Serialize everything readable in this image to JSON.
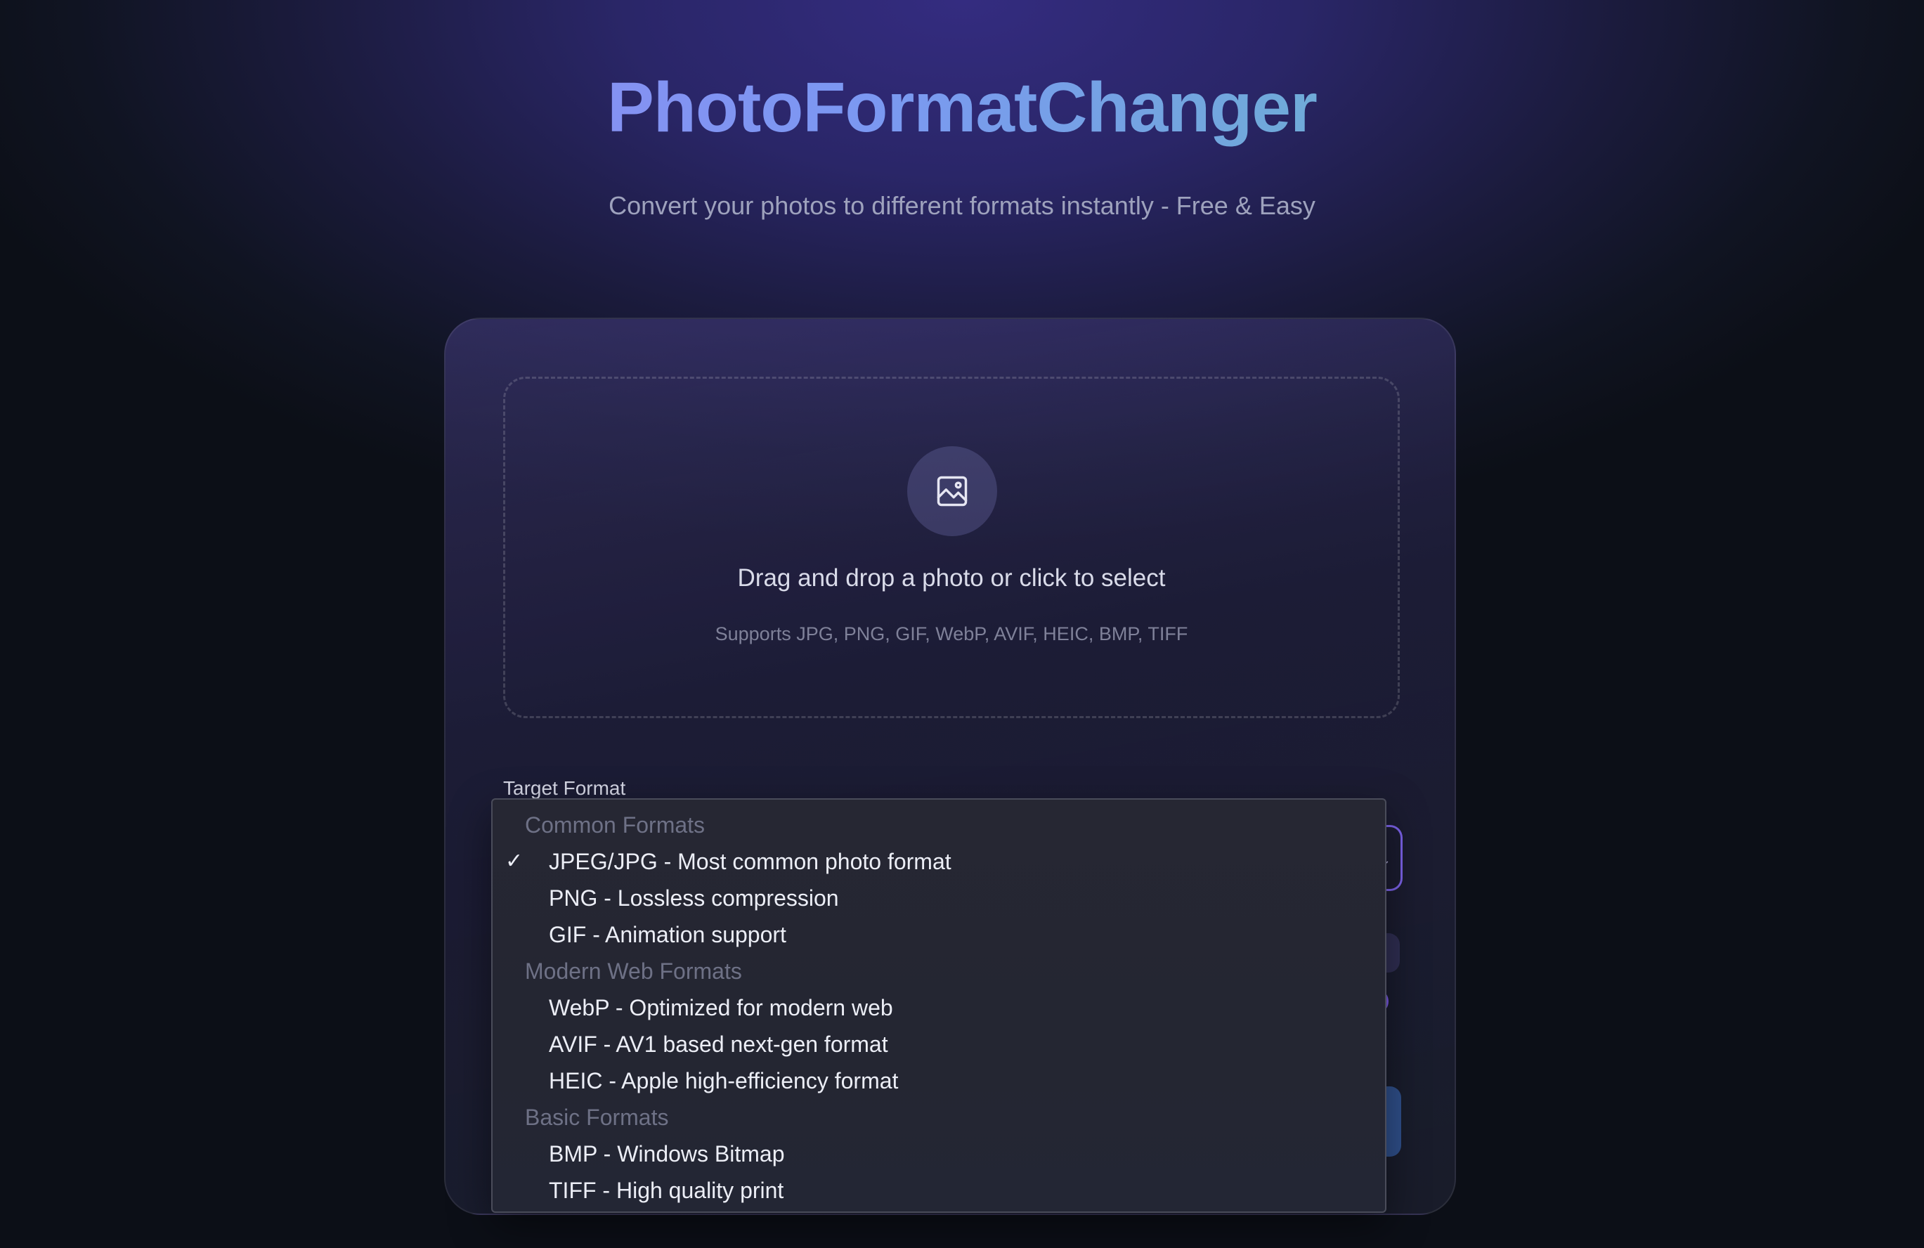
{
  "app": {
    "title": "PhotoFormatChanger",
    "subtitle": "Convert your photos to different formats instantly - Free & Easy"
  },
  "upload": {
    "icon": "image-icon",
    "title": "Drag and drop a photo or click to select",
    "supported": "Supports JPG, PNG, GIF, WebP, AVIF, HEIC, BMP, TIFF"
  },
  "format_select": {
    "label": "Target Format",
    "selected": "JPEG/JPG - Most common photo format",
    "check_glyph": "✓",
    "groups": [
      {
        "header": "Common Formats",
        "options": [
          "JPEG/JPG - Most common photo format",
          "PNG - Lossless compression",
          "GIF - Animation support"
        ]
      },
      {
        "header": "Modern Web Formats",
        "options": [
          "WebP - Optimized for modern web",
          "AVIF - AV1 based next-gen format",
          "HEIC - Apple high-efficiency format"
        ]
      },
      {
        "header": "Basic Formats",
        "options": [
          "BMP - Windows Bitmap",
          "TIFF - High quality print"
        ]
      }
    ]
  },
  "colors": {
    "accent": "#7b62e8",
    "title_gradient_start": "#9a82f4",
    "title_gradient_end": "#5fc3b5"
  }
}
